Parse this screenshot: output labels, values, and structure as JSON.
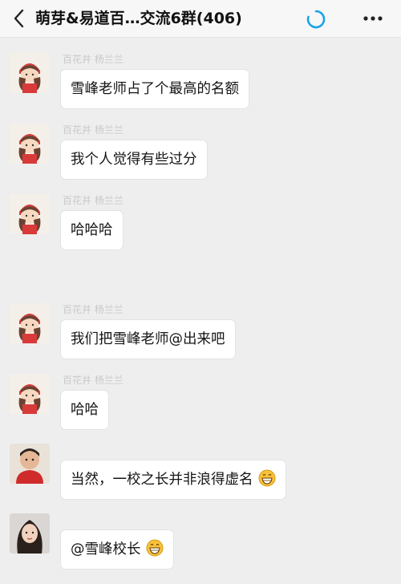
{
  "header": {
    "title": "萌芽&易道百…交流6群(406)",
    "back_icon": "chevron-left-icon",
    "loading_icon": "loading-spinner-icon",
    "menu_icon": "more-dots-icon"
  },
  "messages": [
    {
      "sender": "百花井 杨兰兰",
      "text": "雪峰老师占了个最高的名额"
    },
    {
      "sender": "百花井 杨兰兰",
      "text": "我个人觉得有些过分"
    },
    {
      "sender": "百花井 杨兰兰",
      "text": "哈哈哈"
    },
    {
      "sender": "百花井 杨兰兰",
      "text": "我们把雪峰老师@出来吧"
    },
    {
      "sender": "百花井 杨兰兰",
      "text": "哈哈"
    },
    {
      "sender": "",
      "text": "当然，一校之长并非浪得虚名",
      "emoji": "grinning-face-icon"
    },
    {
      "sender": "",
      "text": "@雪峰校长",
      "emoji": "grinning-face-icon"
    }
  ],
  "colors": {
    "chat_background": "#eeeeee",
    "bubble": "#ffffff",
    "nickname": "#c9c9c9",
    "spinner": "#1aa3e8"
  }
}
